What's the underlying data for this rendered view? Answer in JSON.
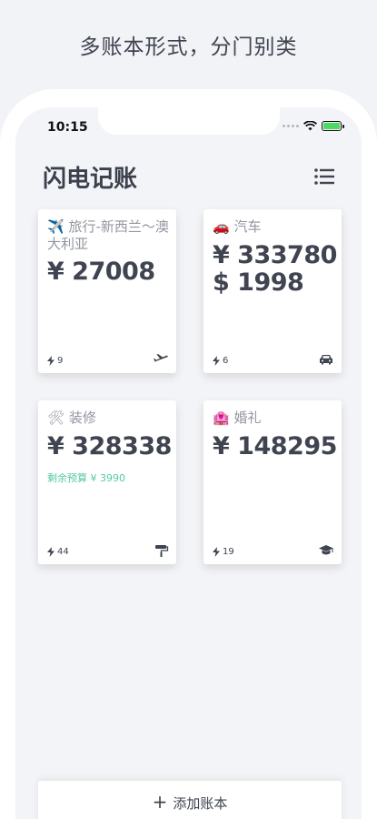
{
  "headline": "多账本形式，分门别类",
  "status_bar": {
    "time": "10:15"
  },
  "app": {
    "title": "闪电记账"
  },
  "books": [
    {
      "emoji": "✈️",
      "name": "旅行-新西兰～澳大利亚",
      "amounts": [
        "¥ 27008"
      ],
      "budget": "",
      "count": "9",
      "icon": "airplane-icon"
    },
    {
      "emoji": "🚗",
      "name": "汽车",
      "amounts": [
        "¥ 333780",
        "$ 1998"
      ],
      "budget": "",
      "count": "6",
      "icon": "car-icon"
    },
    {
      "emoji": "🛠",
      "name": "装修",
      "amounts": [
        "¥ 328338"
      ],
      "budget": "剩余预算 ¥ 3990",
      "count": "44",
      "icon": "paint-roller-icon"
    },
    {
      "emoji": "🏩",
      "name": "婚礼",
      "amounts": [
        "¥ 148295"
      ],
      "budget": "",
      "count": "19",
      "icon": "graduation-cap-icon"
    }
  ],
  "add_button": {
    "label": "添加账本"
  },
  "colors": {
    "accent_green": "#56c9a5",
    "text_dark": "#3f4450"
  }
}
